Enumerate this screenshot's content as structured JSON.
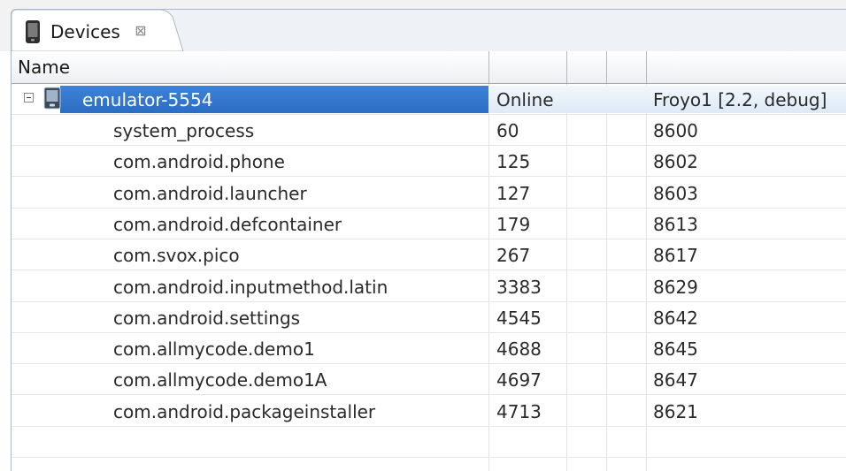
{
  "tab": {
    "label": "Devices",
    "close_glyph": "⊠",
    "icon": "phone-icon"
  },
  "table": {
    "columns": [
      "Name",
      "",
      "",
      "",
      ""
    ],
    "device": {
      "name": "emulator-5554",
      "status": "Online",
      "target": "Froyo1 [2.2, debug]",
      "icon": "emulator-device-icon"
    },
    "processes": [
      {
        "name": "system_process",
        "pid": "60",
        "port": "8600"
      },
      {
        "name": "com.android.phone",
        "pid": "125",
        "port": "8602"
      },
      {
        "name": "com.android.launcher",
        "pid": "127",
        "port": "8603"
      },
      {
        "name": "com.android.defcontainer",
        "pid": "179",
        "port": "8613"
      },
      {
        "name": "com.svox.pico",
        "pid": "267",
        "port": "8617"
      },
      {
        "name": "com.android.inputmethod.latin",
        "pid": "3383",
        "port": "8629"
      },
      {
        "name": "com.android.settings",
        "pid": "4545",
        "port": "8642"
      },
      {
        "name": "com.allmycode.demo1",
        "pid": "4688",
        "port": "8645"
      },
      {
        "name": "com.allmycode.demo1A",
        "pid": "4697",
        "port": "8647"
      },
      {
        "name": "com.android.packageinstaller",
        "pid": "4713",
        "port": "8621"
      }
    ]
  },
  "colors": {
    "selection": "#2c6dc4",
    "selection_text": "#ffffff",
    "header_border": "#a6a6a6"
  }
}
